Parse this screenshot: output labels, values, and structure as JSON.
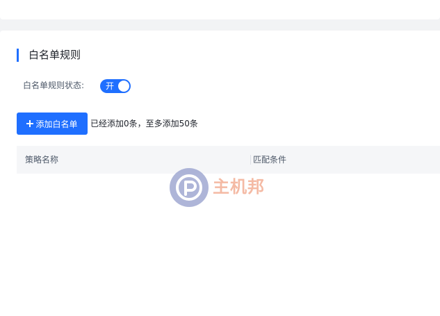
{
  "section": {
    "title": "白名单规则"
  },
  "status": {
    "label": "白名单规则状态:",
    "switch_text": "开",
    "enabled": true
  },
  "toolbar": {
    "add_label": "添加白名单",
    "count_hint": "已经添加0条，至多添加50条"
  },
  "table": {
    "columns": [
      "策略名称",
      "匹配条件"
    ],
    "rows": []
  },
  "watermark": {
    "text": "主机邦"
  },
  "colors": {
    "accent": "#1f6fff",
    "header_bg": "#f5f6f8"
  },
  "icons": {
    "add": "plus-icon",
    "watermark_logo": "watermark-logo-icon"
  }
}
